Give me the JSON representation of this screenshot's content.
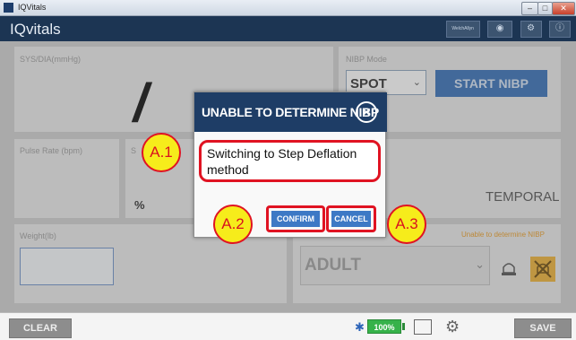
{
  "window": {
    "title": "IQVitals"
  },
  "header": {
    "app_title": "IQvitals",
    "brand_badge": "WelchAllyn"
  },
  "panels": {
    "sys_dia_label": "SYS/DIA(mmHg)",
    "nibp_mode_label": "NIBP Mode",
    "nibp_mode_value": "SPOT",
    "start_nibp_label": "START NIBP",
    "sys_dia_value": "/",
    "pulse_rate_label": "Pulse Rate (bpm)",
    "spo2_label": "S",
    "spo2_unit": "%",
    "temp_mode": "TEMPORAL",
    "weight_label": "Weight(lb)",
    "weight_value": "",
    "nibp_status": "Unable to determine NIBP",
    "patient_type": "ADULT"
  },
  "dialog": {
    "title": "UNABLE TO DETERMINE NIBP",
    "message": "Switching to Step Deflation method",
    "confirm_label": "CONFIRM",
    "cancel_label": "CANCEL"
  },
  "callouts": {
    "a1": "A.1",
    "a2": "A.2",
    "a3": "A.3"
  },
  "footer": {
    "clear_label": "CLEAR",
    "battery_percent": "100%",
    "save_label": "SAVE"
  },
  "colors": {
    "callout_fill": "#f6ec1b",
    "callout_border": "#e01322",
    "dialog_header": "#1e3d66",
    "button_blue": "#3d79c5"
  }
}
